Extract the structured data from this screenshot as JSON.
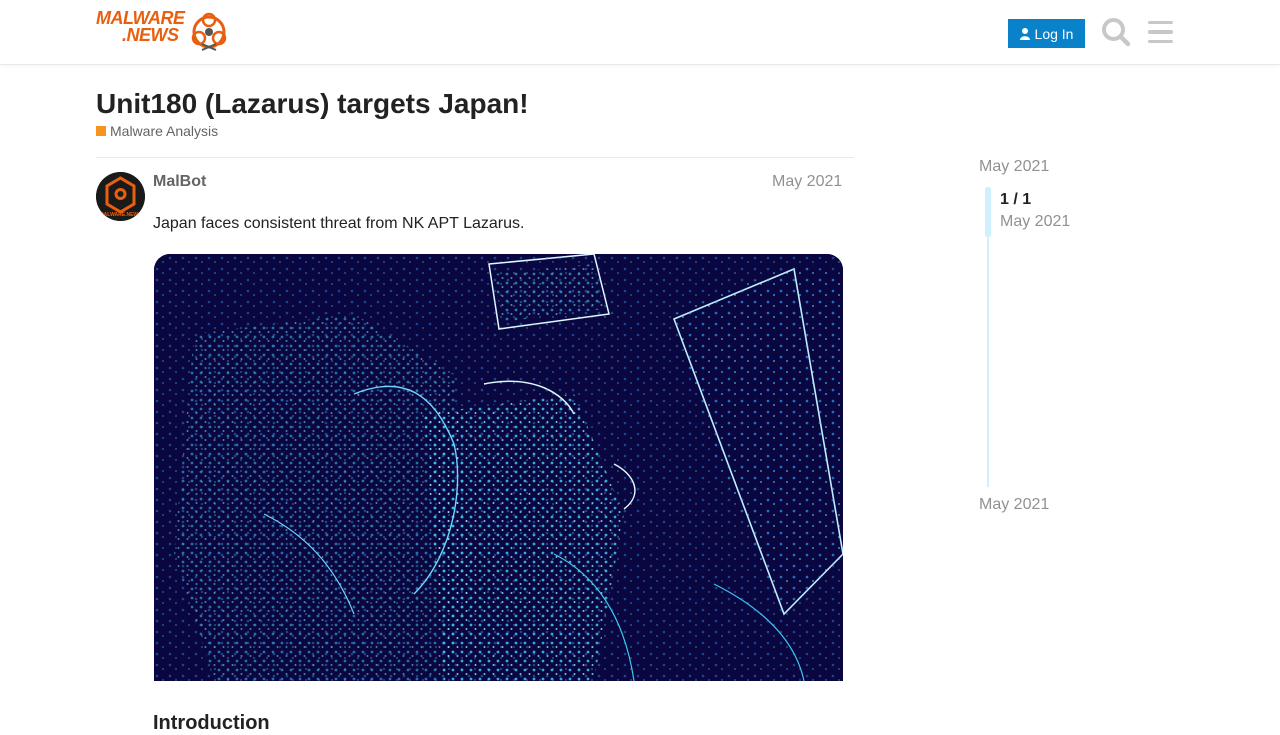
{
  "header": {
    "logo_line1": "MALWARE",
    "logo_line2": ".NEWS",
    "login_label": "Log In",
    "search_icon": "search-icon",
    "menu_icon": "hamburger-menu-icon",
    "accent_color": "#0a82c9",
    "logo_color": "#e8600f"
  },
  "topic": {
    "title": "Unit180 (Lazarus) targets Japan!",
    "category": "Malware Analysis",
    "category_color": "#f7941d"
  },
  "post": {
    "author": "MalBot",
    "date": "May 2021",
    "avatar_text": "MALWARE.NEWS",
    "body": "Japan faces consistent threat from NK APT Lazarus.",
    "next_heading": "Introduction"
  },
  "timeline": {
    "start_date": "May 2021",
    "position": "1 / 1",
    "position_date": "May 2021",
    "end_date": "May 2021"
  }
}
